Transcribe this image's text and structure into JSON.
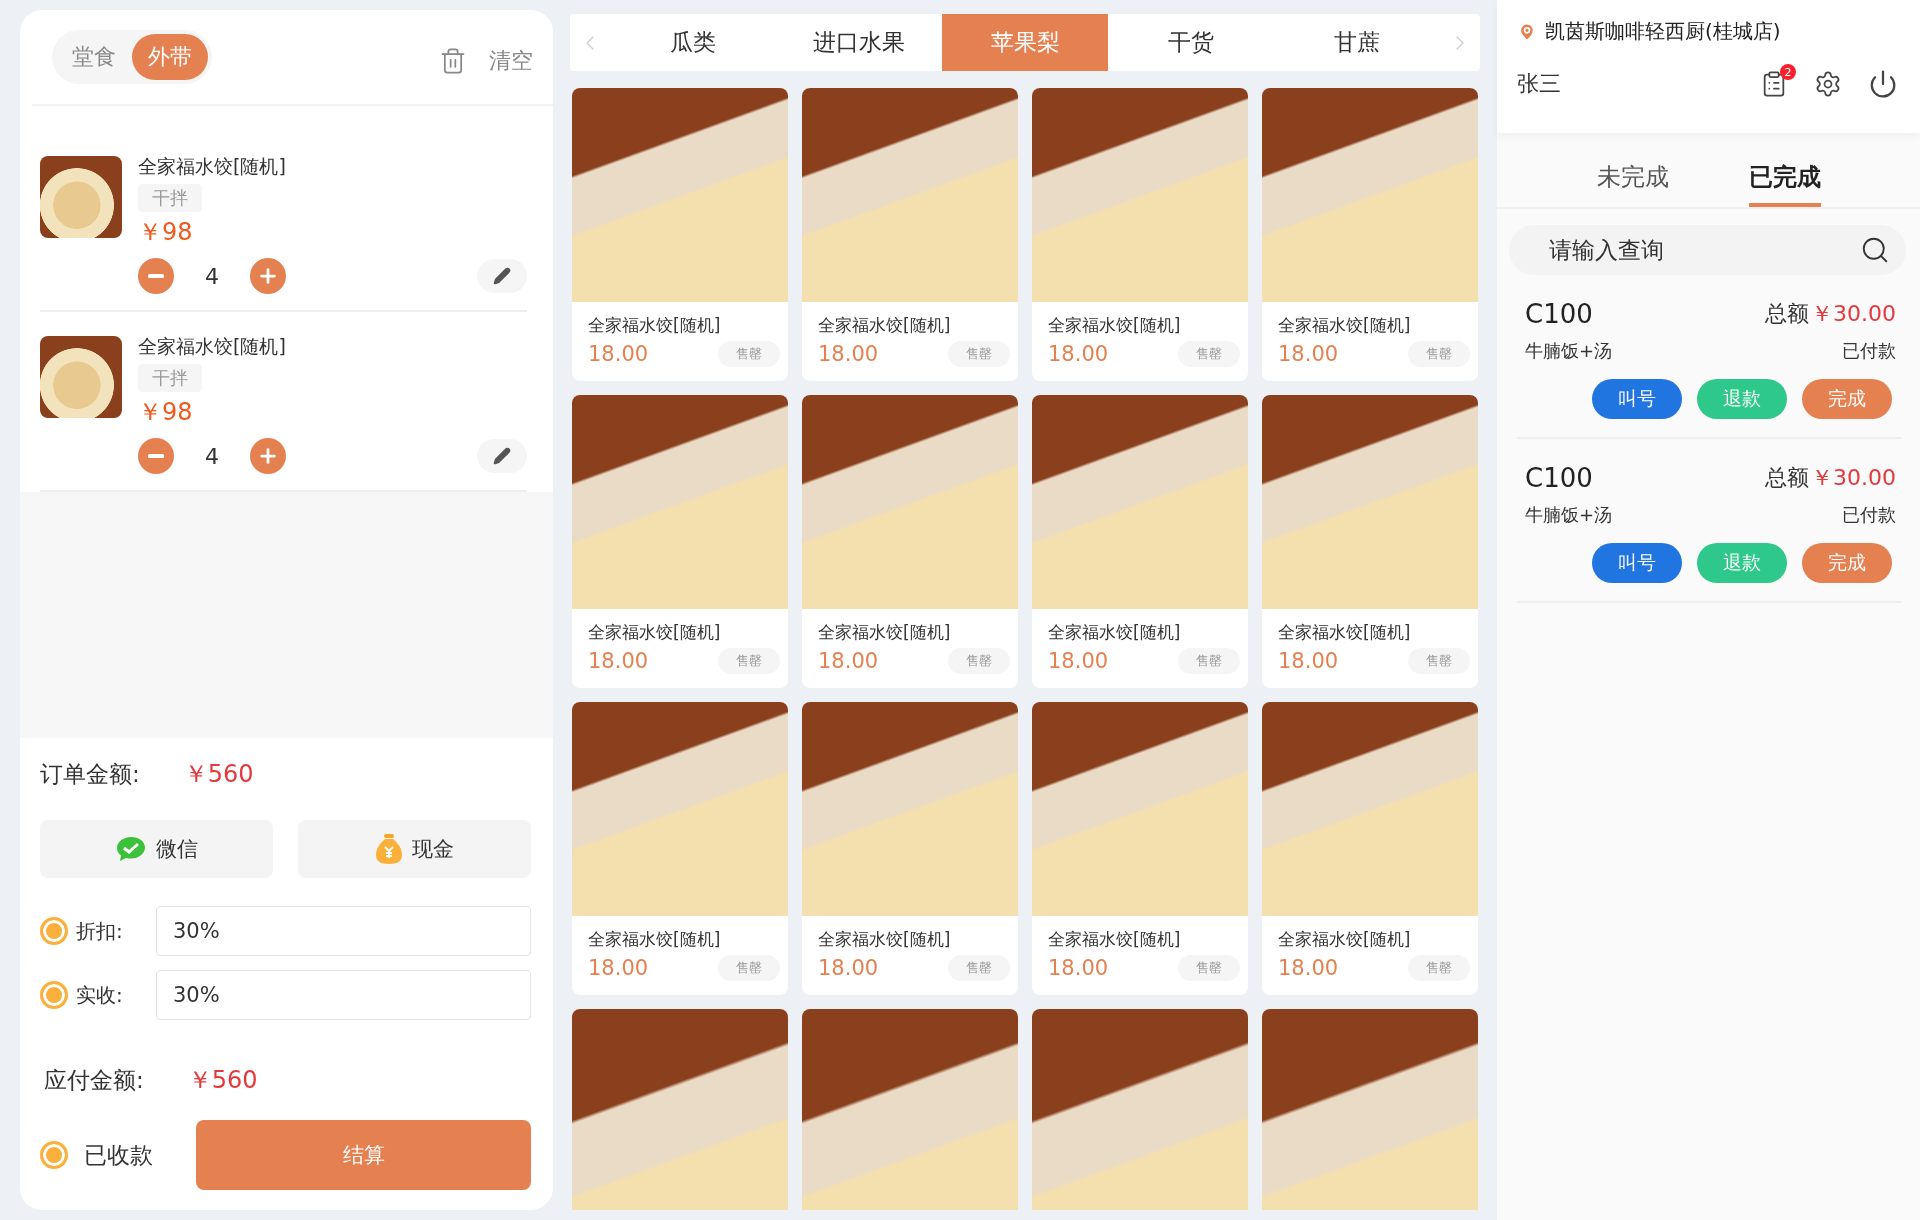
{
  "order_type": [
    {
      "label": "堂食",
      "selected": false
    },
    {
      "label": "外带",
      "selected": true
    }
  ],
  "clear": {
    "label": "清空"
  },
  "cart": [
    {
      "name": "全家福水饺[随机]",
      "tag": "干拌",
      "price": "￥98",
      "qty": "4"
    },
    {
      "name": "全家福水饺[随机]",
      "tag": "干拌",
      "price": "￥98",
      "qty": "4"
    }
  ],
  "summary": {
    "order_label": "订单金额:",
    "order_amount": "￥560",
    "payments": [
      {
        "kind": "wechat",
        "label": "微信"
      },
      {
        "kind": "cash",
        "label": "现金"
      }
    ],
    "fields": [
      {
        "label": "折扣:",
        "value": "30%",
        "selected": true
      },
      {
        "label": "实收:",
        "value": "30%",
        "selected": true
      }
    ],
    "due_label": "应付金额:",
    "due_amount": "￥560",
    "received": {
      "label": "已收款",
      "selected": true
    },
    "checkout": "结算"
  },
  "categories": [
    {
      "label": "瓜类",
      "selected": false
    },
    {
      "label": "进口水果",
      "selected": false
    },
    {
      "label": "苹果梨",
      "selected": true
    },
    {
      "label": "干货",
      "selected": false
    },
    {
      "label": "甘蔗",
      "selected": false
    }
  ],
  "products": [
    {
      "kind": "full",
      "name": "全家福水饺[随机]",
      "price": "18.00",
      "badge": "售罄"
    },
    {
      "kind": "full",
      "name": "全家福水饺[随机]",
      "price": "18.00",
      "badge": "售罄"
    },
    {
      "kind": "full",
      "name": "全家福水饺[随机]",
      "price": "18.00",
      "badge": "售罄"
    },
    {
      "kind": "full",
      "name": "全家福水饺[随机]",
      "price": "18.00",
      "badge": "售罄"
    },
    {
      "kind": "full",
      "name": "全家福水饺[随机]",
      "price": "18.00",
      "badge": "售罄"
    },
    {
      "kind": "full",
      "name": "全家福水饺[随机]",
      "price": "18.00",
      "badge": "售罄"
    },
    {
      "kind": "full",
      "name": "全家福水饺[随机]",
      "price": "18.00",
      "badge": "售罄"
    },
    {
      "kind": "full",
      "name": "全家福水饺[随机]",
      "price": "18.00",
      "badge": "售罄"
    },
    {
      "kind": "full",
      "name": "全家福水饺[随机]",
      "price": "18.00",
      "badge": "售罄"
    },
    {
      "kind": "full",
      "name": "全家福水饺[随机]",
      "price": "18.00",
      "badge": "售罄"
    },
    {
      "kind": "full",
      "name": "全家福水饺[随机]",
      "price": "18.00",
      "badge": "售罄"
    },
    {
      "kind": "full",
      "name": "全家福水饺[随机]",
      "price": "18.00",
      "badge": "售罄"
    },
    {
      "kind": "image_only"
    },
    {
      "kind": "image_only"
    },
    {
      "kind": "image_only"
    },
    {
      "kind": "image_only"
    }
  ],
  "store": {
    "name": "凯茵斯咖啡轻西厨(桂城店)",
    "user": "张三",
    "badge": "2"
  },
  "order_tabs": [
    {
      "label": "未完成",
      "selected": false
    },
    {
      "label": "已完成",
      "selected": true
    }
  ],
  "search": {
    "placeholder": "请输入查询"
  },
  "orders": [
    {
      "code": "C100",
      "total_label": "总额",
      "total": "￥30.00",
      "items": "牛腩饭+汤",
      "status": "已付款",
      "actions": [
        {
          "kind": "call",
          "label": "叫号"
        },
        {
          "kind": "refund",
          "label": "退款"
        },
        {
          "kind": "done",
          "label": "完成"
        }
      ]
    },
    {
      "code": "C100",
      "total_label": "总额",
      "total": "￥30.00",
      "items": "牛腩饭+汤",
      "status": "已付款",
      "actions": [
        {
          "kind": "call",
          "label": "叫号"
        },
        {
          "kind": "refund",
          "label": "退款"
        },
        {
          "kind": "done",
          "label": "完成"
        }
      ]
    }
  ]
}
